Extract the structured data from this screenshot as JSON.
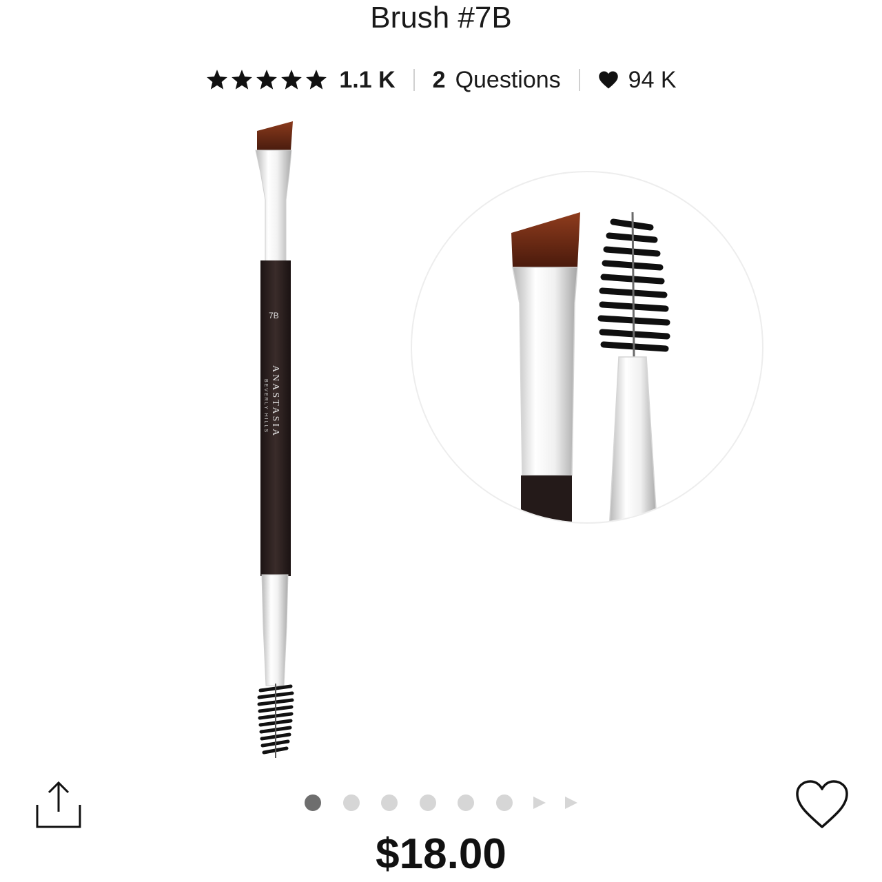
{
  "product": {
    "title": "Brush #7B",
    "price": "$18.00",
    "brand_mark": "ANASTASIA",
    "brand_sub": "BEVERLY HILLS",
    "brush_number": "7B"
  },
  "meta": {
    "rating_stars": 5,
    "rating_count": "1.1 K",
    "questions_count": "2",
    "questions_label": "Questions",
    "loves_count": "94 K"
  },
  "carousel": {
    "dot_count": 6,
    "active_index": 0,
    "arrow_count": 2
  },
  "icons": {
    "star": "star-icon",
    "heart_small": "heart-filled-icon",
    "share": "share-icon",
    "favorite": "heart-outline-icon"
  },
  "colors": {
    "text": "#111111",
    "dot_active": "#6e6e6e",
    "dot_inactive": "#d6d6d6",
    "handle": "#2a1f1f",
    "bristle_brown": "#6b2a15"
  }
}
